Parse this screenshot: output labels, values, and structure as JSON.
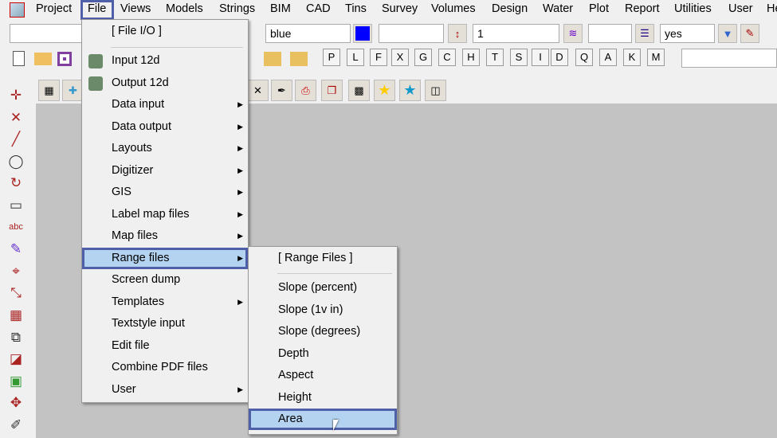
{
  "menubar": {
    "items": [
      "Project",
      "File",
      "Views",
      "Models",
      "Strings",
      "BIM",
      "CAD",
      "Tins",
      "Survey",
      "Volumes",
      "Design",
      "Water",
      "Plot",
      "Report",
      "Utilities",
      "User",
      "He"
    ]
  },
  "toolbar": {
    "colour_value": "blue",
    "colour_swatch": "#0000ff",
    "height_value": "1",
    "flag_value": "yes"
  },
  "letters": [
    "P",
    "L",
    "F",
    "X",
    "G",
    "C",
    "H",
    "T",
    "S",
    "I",
    "D",
    "Q",
    "A",
    "K",
    "M"
  ],
  "file_menu": {
    "header": "[ File I/O ]",
    "items": [
      {
        "label": "Input 12d",
        "submenu": false
      },
      {
        "label": "Output 12d",
        "submenu": false
      },
      {
        "label": "Data input",
        "submenu": true
      },
      {
        "label": "Data output",
        "submenu": true
      },
      {
        "label": "Layouts",
        "submenu": true
      },
      {
        "label": "Digitizer",
        "submenu": true
      },
      {
        "label": "GIS",
        "submenu": true
      },
      {
        "label": "Label map files",
        "submenu": true
      },
      {
        "label": "Map files",
        "submenu": true
      },
      {
        "label": "Range files",
        "submenu": true
      },
      {
        "label": "Screen dump",
        "submenu": false
      },
      {
        "label": "Templates",
        "submenu": true
      },
      {
        "label": "Textstyle input",
        "submenu": false
      },
      {
        "label": "Edit file",
        "submenu": false
      },
      {
        "label": "Combine PDF files",
        "submenu": false
      },
      {
        "label": "User",
        "submenu": true
      }
    ]
  },
  "range_menu": {
    "header": "[ Range Files ]",
    "items": [
      "Slope (percent)",
      "Slope (1v in)",
      "Slope (degrees)",
      "Depth",
      "Aspect",
      "Height",
      "Area"
    ]
  },
  "colors": {
    "highlight": "#b4d3f0",
    "accent": "#4f5fa8"
  }
}
